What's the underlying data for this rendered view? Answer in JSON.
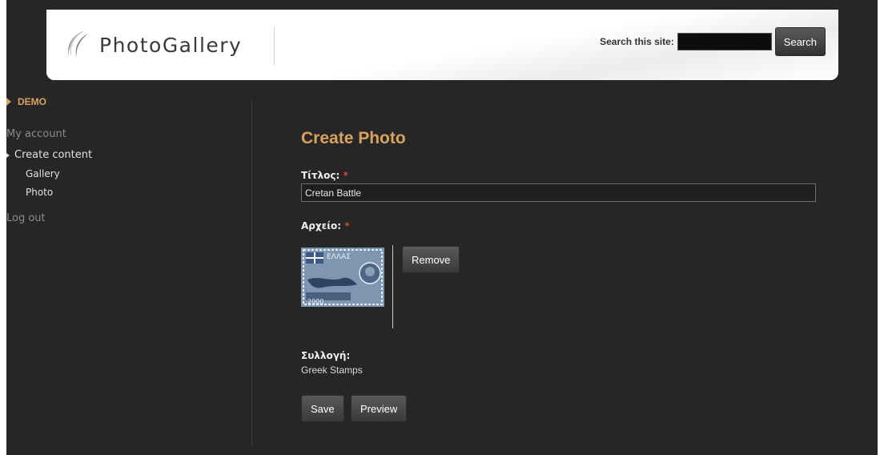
{
  "header": {
    "logo_text": "PhotoGallery",
    "search_label": "Search this site:",
    "search_value": "",
    "search_button": "Search"
  },
  "sidebar": {
    "user_name": "DEMO",
    "items": [
      {
        "label": "My account"
      },
      {
        "label": "Create content"
      },
      {
        "label": "Gallery"
      },
      {
        "label": "Photo"
      },
      {
        "label": "Log out"
      }
    ]
  },
  "form": {
    "page_title": "Create Photo",
    "title_label": "Τίτλος:",
    "title_value": "Cretan Battle",
    "file_label": "Αρχείο:",
    "thumbnail": {
      "text_top": "ΕΛΛΑΣ",
      "text_bottom": "2000"
    },
    "remove_button": "Remove",
    "collection_label": "Συλλογή:",
    "collection_value": "Greek Stamps",
    "save_button": "Save",
    "preview_button": "Preview",
    "required_mark": "*"
  },
  "colors": {
    "background": "#262626",
    "accent": "#d9a25e",
    "required": "#d8443a"
  }
}
